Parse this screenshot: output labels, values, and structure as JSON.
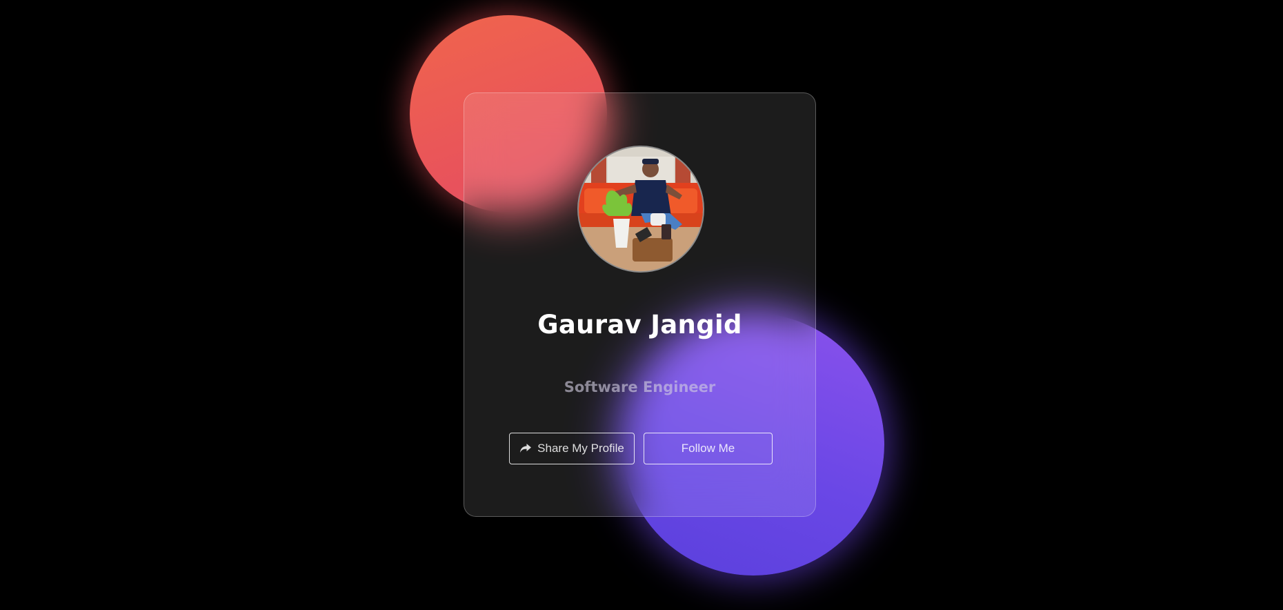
{
  "profile": {
    "name": "Gaurav Jangid",
    "title": "Software Engineer"
  },
  "actions": {
    "share_label": "Share My Profile",
    "follow_label": "Follow Me",
    "share_icon": "share-arrow-icon"
  },
  "colors": {
    "background": "#000000",
    "blob_red": "#e8525c",
    "blob_purple": "#6a47e6",
    "card_border": "rgba(255,255,255,0.28)"
  }
}
